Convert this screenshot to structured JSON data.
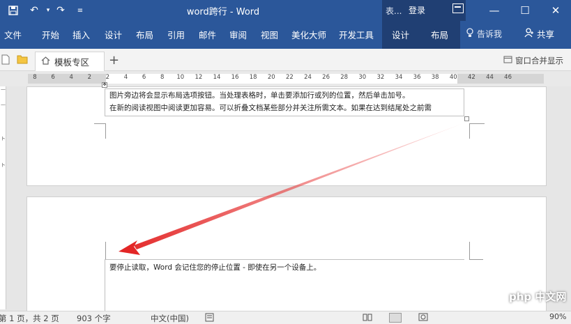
{
  "titlebar": {
    "title": "word跨行 - Word",
    "context_group": "表...",
    "login": "登录",
    "minimize": "—",
    "maximize": "☐",
    "close": "✕",
    "color": "#2b579a"
  },
  "ribbon": {
    "tabs": [
      "文件",
      "开始",
      "插入",
      "设计",
      "布局",
      "引用",
      "邮件",
      "审阅",
      "视图",
      "美化大师",
      "开发工具"
    ],
    "context_tabs": [
      "设计",
      "布局"
    ],
    "tell_me": "告诉我",
    "share": "共享"
  },
  "tabbar": {
    "template_tab": "模板专区",
    "add_tab": "+",
    "merge_windows": "窗口合并显示"
  },
  "ruler": {
    "numbers": [
      "8",
      "6",
      "4",
      "2",
      "2",
      "4",
      "6",
      "8",
      "10",
      "12",
      "14",
      "16",
      "18",
      "20",
      "22",
      "24",
      "26",
      "28",
      "30",
      "32",
      "34",
      "36",
      "38",
      "40",
      "42",
      "44",
      "46"
    ]
  },
  "document": {
    "page1_line1": "图片旁边将会显示布局选项按钮。当处理表格时，单击要添加行或列的位置，然后单击加号。",
    "page1_line2": "在新的阅读视图中阅读更加容易。可以折叠文档某些部分并关注所需文本。如果在达到结尾处之前需",
    "page2_line1": "要停止读取，Word 会记住您的停止位置 - 即使在另一个设备上。"
  },
  "statusbar": {
    "page": "第 1 页，共 2 页",
    "words": "903 个字",
    "language": "中文(中国)",
    "zoom": "90%"
  },
  "watermark": "php 中文网"
}
